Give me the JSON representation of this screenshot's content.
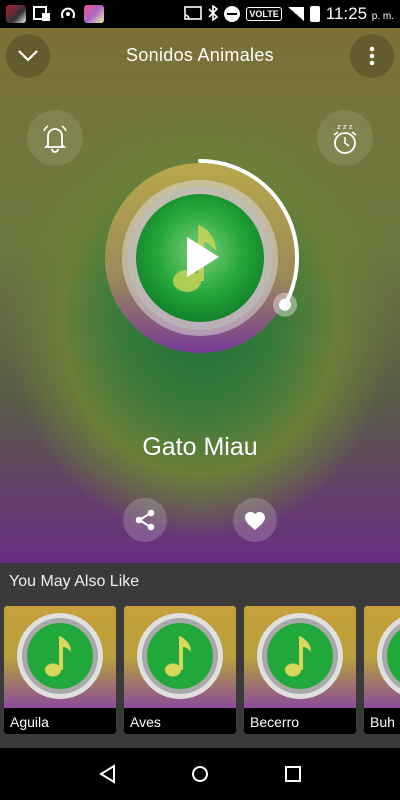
{
  "status_bar": {
    "time": "11:25",
    "time_suffix": "p. m.",
    "network_badge": "VOLTE",
    "icons": [
      "app-icon",
      "cast-doc-icon",
      "hotspot-icon",
      "app-icon",
      "cast-icon",
      "bluetooth-icon",
      "do-not-disturb-icon",
      "volte-icon",
      "signal-icon",
      "battery-icon"
    ]
  },
  "header": {
    "title": "Sonidos Animales"
  },
  "player": {
    "song_title": "Gato Miau",
    "progress_fraction": 0.33,
    "state": "paused"
  },
  "suggestions": {
    "heading": "You May Also Like",
    "items": [
      {
        "label": "Aguila"
      },
      {
        "label": "Aves"
      },
      {
        "label": "Becerro"
      },
      {
        "label": "Buh"
      }
    ]
  },
  "colors": {
    "accent_green": "#22a33a",
    "note_yellow": "#d8d85a",
    "purple": "#6a2d84",
    "panel_dark": "#3a3a3a"
  }
}
